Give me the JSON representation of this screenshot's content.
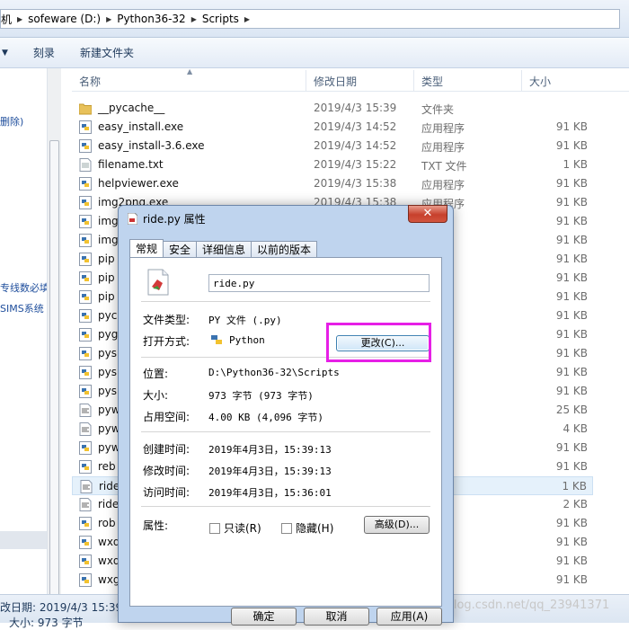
{
  "address": {
    "crumbs": [
      "机",
      "sofeware (D:)",
      "Python36-32",
      "Scripts"
    ]
  },
  "toolbar": {
    "items": [
      "",
      "刻录",
      "新建文件夹"
    ]
  },
  "nav": {
    "labels": [
      "删除)",
      "专线数必填",
      "SIMS系统"
    ]
  },
  "columns": {
    "name": "名称",
    "date": "修改日期",
    "type": "类型",
    "size": "大小"
  },
  "files": [
    {
      "name": "__pycache__",
      "date": "2019/4/3 15:39",
      "type": "文件夹",
      "size": "",
      "icon": "folder-icon"
    },
    {
      "name": "easy_install.exe",
      "date": "2019/4/3 14:52",
      "type": "应用程序",
      "size": "91 KB",
      "icon": "python-exe-icon"
    },
    {
      "name": "easy_install-3.6.exe",
      "date": "2019/4/3 14:52",
      "type": "应用程序",
      "size": "91 KB",
      "icon": "python-exe-icon"
    },
    {
      "name": "filename.txt",
      "date": "2019/4/3 15:22",
      "type": "TXT 文件",
      "size": "1 KB",
      "icon": "text-file-icon"
    },
    {
      "name": "helpviewer.exe",
      "date": "2019/4/3 15:38",
      "type": "应用程序",
      "size": "91 KB",
      "icon": "python-exe-icon"
    },
    {
      "name": "img2png.exe",
      "date": "2019/4/3 15:38",
      "type": "应用程序",
      "size": "91 KB",
      "icon": "python-exe-icon"
    },
    {
      "name": "img",
      "date": "",
      "type": "序",
      "size": "91 KB",
      "icon": "python-exe-icon"
    },
    {
      "name": "img",
      "date": "",
      "type": "序",
      "size": "91 KB",
      "icon": "python-exe-icon"
    },
    {
      "name": "pip",
      "date": "",
      "type": "序",
      "size": "91 KB",
      "icon": "python-exe-icon"
    },
    {
      "name": "pip",
      "date": "",
      "type": "序",
      "size": "91 KB",
      "icon": "python-exe-icon"
    },
    {
      "name": "pip",
      "date": "",
      "type": "序",
      "size": "91 KB",
      "icon": "python-exe-icon"
    },
    {
      "name": "pyc",
      "date": "",
      "type": "序",
      "size": "91 KB",
      "icon": "python-exe-icon"
    },
    {
      "name": "pyg",
      "date": "",
      "type": "序",
      "size": "91 KB",
      "icon": "python-exe-icon"
    },
    {
      "name": "pys",
      "date": "",
      "type": "序",
      "size": "91 KB",
      "icon": "python-exe-icon"
    },
    {
      "name": "pys",
      "date": "",
      "type": "序",
      "size": "91 KB",
      "icon": "python-exe-icon"
    },
    {
      "name": "pys",
      "date": "",
      "type": "序",
      "size": "91 KB",
      "icon": "python-exe-icon"
    },
    {
      "name": "pyw",
      "date": "",
      "type": "",
      "size": "25 KB",
      "icon": "script-file-icon"
    },
    {
      "name": "pyw",
      "date": "",
      "type": "",
      "size": "4 KB",
      "icon": "script-file-icon"
    },
    {
      "name": "pyw",
      "date": "",
      "type": "序",
      "size": "91 KB",
      "icon": "python-exe-icon"
    },
    {
      "name": "reb",
      "date": "",
      "type": "序",
      "size": "91 KB",
      "icon": "python-exe-icon"
    },
    {
      "name": "ride",
      "date": "",
      "type": "",
      "size": "1 KB",
      "icon": "script-file-icon",
      "selected": true
    },
    {
      "name": "ride",
      "date": "",
      "type": "",
      "size": "2 KB",
      "icon": "script-file-icon"
    },
    {
      "name": "rob",
      "date": "",
      "type": "序",
      "size": "91 KB",
      "icon": "python-exe-icon"
    },
    {
      "name": "wxd",
      "date": "",
      "type": "序",
      "size": "91 KB",
      "icon": "python-exe-icon"
    },
    {
      "name": "wxd",
      "date": "",
      "type": "序",
      "size": "91 KB",
      "icon": "python-exe-icon"
    },
    {
      "name": "wxg",
      "date": "",
      "type": "序",
      "size": "91 KB",
      "icon": "python-exe-icon"
    }
  ],
  "status": {
    "line1": "改日期: 2019/4/3 15:39",
    "line2": "大小: 973 字节"
  },
  "watermark": "https://blog.csdn.net/qq_23941371",
  "dialog": {
    "title": "ride.py 属性",
    "close": "✕",
    "tabs": [
      "常规",
      "安全",
      "详细信息",
      "以前的版本"
    ],
    "filename": "ride.py",
    "filetype_label": "文件类型:",
    "filetype_value": "PY 文件 (.py)",
    "openwith_label": "打开方式:",
    "openwith_value": "Python",
    "change_button": "更改(C)...",
    "location_label": "位置:",
    "location_value": "D:\\Python36-32\\Scripts",
    "size_label": "大小:",
    "size_value": "973 字节 (973 字节)",
    "ondisk_label": "占用空间:",
    "ondisk_value": "4.00 KB (4,096 字节)",
    "created_label": "创建时间:",
    "created_value": "2019年4月3日，15:39:13",
    "modified_label": "修改时间:",
    "modified_value": "2019年4月3日，15:39:13",
    "accessed_label": "访问时间:",
    "accessed_value": "2019年4月3日，15:36:01",
    "attr_label": "属性:",
    "readonly_label": "只读(R)",
    "hidden_label": "隐藏(H)",
    "advanced_button": "高级(D)...",
    "ok_button": "确定",
    "cancel_button": "取消",
    "apply_button": "应用(A)"
  },
  "colors": {
    "highlight": "#e61fe6",
    "link": "#1f4e9c",
    "selection": "#e5f1fb"
  }
}
